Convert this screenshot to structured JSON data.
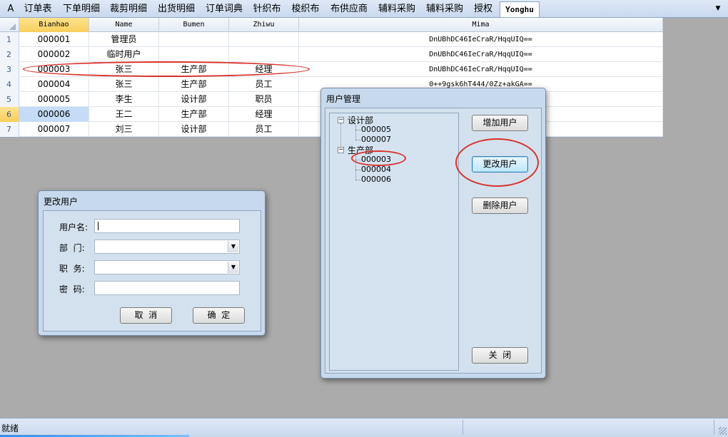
{
  "tabs": [
    "A",
    "订单表",
    "下单明细",
    "裁剪明细",
    "出货明细",
    "订单词典",
    "针织布",
    "梭织布",
    "布供应商",
    "辅料采购",
    "辅料采购",
    "授权",
    "Yonghu"
  ],
  "grid": {
    "columns": [
      "Bianhao",
      "Name",
      "Bumen",
      "Zhiwu",
      "Mima"
    ],
    "rows": [
      {
        "num": "1",
        "bianhao": "000001",
        "name": "管理员",
        "bumen": "",
        "zhiwu": "",
        "mima": "DnUBhDC46IeCraR/HqqUIQ=="
      },
      {
        "num": "2",
        "bianhao": "000002",
        "name": "临时用户",
        "bumen": "",
        "zhiwu": "",
        "mima": "DnUBhDC46IeCraR/HqqUIQ=="
      },
      {
        "num": "3",
        "bianhao": "000003",
        "name": "张三",
        "bumen": "生产部",
        "zhiwu": "经理",
        "mima": "DnUBhDC46IeCraR/HqqUIQ=="
      },
      {
        "num": "4",
        "bianhao": "000004",
        "name": "张三",
        "bumen": "生产部",
        "zhiwu": "员工",
        "mima": "0++9gsk6hT444/0Zz+akGA=="
      },
      {
        "num": "5",
        "bianhao": "000005",
        "name": "李生",
        "bumen": "设计部",
        "zhiwu": "职员",
        "mima": ""
      },
      {
        "num": "6",
        "bianhao": "000006",
        "name": "王二",
        "bumen": "生产部",
        "zhiwu": "经理",
        "mima": ""
      },
      {
        "num": "7",
        "bianhao": "000007",
        "name": "刘三",
        "bumen": "设计部",
        "zhiwu": "员工",
        "mima": ""
      }
    ]
  },
  "user_mgmt": {
    "title": "用户管理",
    "tree": [
      {
        "dept": "设计部",
        "users": [
          "000005",
          "000007"
        ]
      },
      {
        "dept": "生产部",
        "users": [
          "000003",
          "000004",
          "000006"
        ]
      }
    ],
    "add_label": "增加用户",
    "edit_label": "更改用户",
    "delete_label": "删除用户",
    "close_label": "关  闭"
  },
  "edit_user": {
    "title": "更改用户",
    "username_label": "用户名:",
    "dept_label": "部  门:",
    "position_label": "职  务:",
    "password_label": "密  码:",
    "username_value": "",
    "dept_value": "",
    "position_value": "",
    "password_value": "",
    "cancel_label": "取  消",
    "ok_label": "确  定"
  },
  "status": {
    "text": "就绪"
  },
  "colors": {
    "highlight_red": "#d9312b",
    "header_selected": "#f8cf5c",
    "selected_cell": "#c4dcf6"
  }
}
